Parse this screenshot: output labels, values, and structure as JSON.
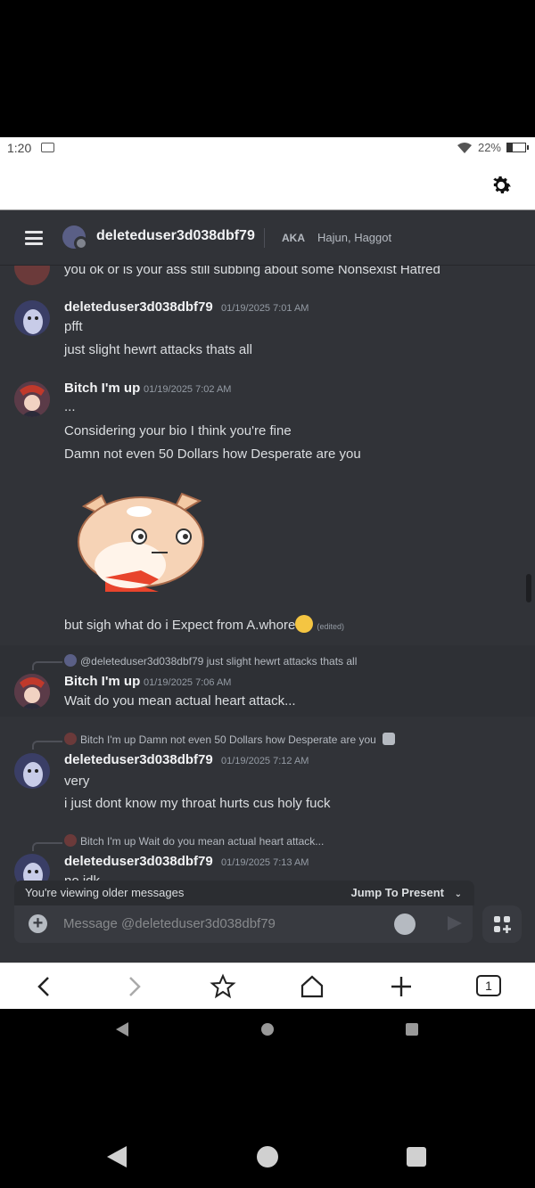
{
  "status": {
    "time": "1:20",
    "battery": "22%"
  },
  "discord": {
    "header": {
      "username": "deleteduser3d038dbf79",
      "aka_label": "AKA",
      "aka_names": "Hajun, Haggot"
    },
    "messages": [
      {
        "text": "you ok or is your ass still subbing about some Nonsexist Hatred"
      },
      {
        "author": "deleteduser3d038dbf79",
        "time": "01/19/2025 7:01 AM",
        "lines": [
          "pfft",
          "just slight hewrt attacks thats all"
        ]
      },
      {
        "author": "Bitch I'm up",
        "time": "01/19/2025 7:02 AM",
        "lines": [
          "...",
          "Considering your bio I think you're fine",
          "Damn not even 50 Dollars how Desperate are you"
        ]
      },
      {
        "text": "but sigh what do i Expect from A.whore",
        "edited": "(edited)"
      },
      {
        "reply": "@deleteduser3d038dbf79 just slight hewrt attacks thats all",
        "author": "Bitch I'm up",
        "time": "01/19/2025 7:06 AM",
        "lines": [
          "Wait do you mean actual heart attack..."
        ]
      },
      {
        "reply": "Bitch I'm up Damn not even 50 Dollars how Desperate are you",
        "author": "deleteduser3d038dbf79",
        "time": "01/19/2025 7:12 AM",
        "lines": [
          "very",
          "i just dont know my throat hurts cus holy fuck"
        ]
      },
      {
        "reply": "Bitch I'm up Wait do you mean actual heart attack...",
        "author": "deleteduser3d038dbf79",
        "time": "01/19/2025 7:13 AM",
        "lines": [
          "no idk"
        ]
      }
    ],
    "older_notice": "You're viewing older messages",
    "jump_label": "Jump To Present",
    "composer_placeholder": "Message @deleteduser3d038dbf79"
  },
  "browser": {
    "tab_count": "1"
  },
  "icons": [
    "gear-icon",
    "hamburger-icon",
    "emoji-icon",
    "send-icon",
    "apps-icon",
    "back-icon",
    "forward-icon",
    "star-icon",
    "home-icon",
    "plus-icon",
    "tabs-icon"
  ]
}
